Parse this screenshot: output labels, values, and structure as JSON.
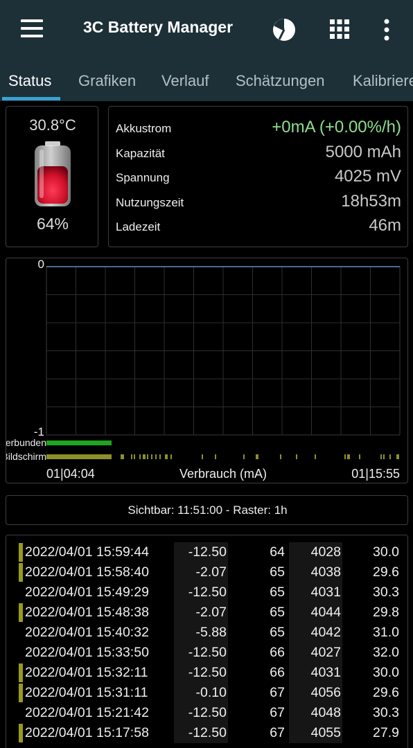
{
  "app": {
    "title": "3C Battery Manager",
    "icons": [
      "menu-icon",
      "pie-chart-icon",
      "grid-icon",
      "more-vert-icon"
    ]
  },
  "tabs": [
    {
      "label": "Status",
      "active": true
    },
    {
      "label": "Grafiken",
      "active": false
    },
    {
      "label": "Verlauf",
      "active": false
    },
    {
      "label": "Schätzungen",
      "active": false
    },
    {
      "label": "Kalibrieren",
      "active": false
    }
  ],
  "battery": {
    "temperature": "30.8°C",
    "percent": "64%"
  },
  "info": [
    {
      "label": "Akkustrom",
      "value": "+0mA (+0.00%/h)",
      "color": "#8ee08e"
    },
    {
      "label": "Kapazität",
      "value": "5000 mAh"
    },
    {
      "label": "Spannung",
      "value": "4025 mV"
    },
    {
      "label": "Nutzungszeit",
      "value": "18h53m"
    },
    {
      "label": "Ladezeit",
      "value": "46m"
    }
  ],
  "chart_data": {
    "type": "line",
    "ylim": [
      -1,
      0
    ],
    "y_ticks": [
      "0",
      "-1"
    ],
    "x_start": "01|04:04",
    "x_end": "01|15:55",
    "xlabel": "Verbrauch (mA)",
    "series": [
      {
        "values": [
          0,
          0
        ]
      }
    ],
    "tracks": [
      {
        "name": "Verbunden",
        "color": "#1fa51f"
      },
      {
        "name": "Bildschirm",
        "color": "#8f8f2a"
      }
    ]
  },
  "visible": {
    "text": "Sichtbar: 11:51:00 - Raster: 1h"
  },
  "history": [
    {
      "marker": true,
      "datetime": "2022/04/01 15:59:44",
      "ma": "-12.50",
      "pct": "64",
      "mv": "4028",
      "temp": "30.0"
    },
    {
      "marker": true,
      "datetime": "2022/04/01 15:58:40",
      "ma": "-2.07",
      "pct": "65",
      "mv": "4038",
      "temp": "29.6"
    },
    {
      "marker": false,
      "datetime": "2022/04/01 15:49:29",
      "ma": "-12.50",
      "pct": "65",
      "mv": "4031",
      "temp": "30.3"
    },
    {
      "marker": true,
      "datetime": "2022/04/01 15:48:38",
      "ma": "-2.07",
      "pct": "65",
      "mv": "4044",
      "temp": "29.8"
    },
    {
      "marker": false,
      "datetime": "2022/04/01 15:40:32",
      "ma": "-5.88",
      "pct": "65",
      "mv": "4042",
      "temp": "31.0"
    },
    {
      "marker": false,
      "datetime": "2022/04/01 15:33:50",
      "ma": "-12.50",
      "pct": "66",
      "mv": "4027",
      "temp": "32.0"
    },
    {
      "marker": true,
      "datetime": "2022/04/01 15:32:11",
      "ma": "-12.50",
      "pct": "66",
      "mv": "4031",
      "temp": "30.0"
    },
    {
      "marker": true,
      "datetime": "2022/04/01 15:31:11",
      "ma": "-0.10",
      "pct": "67",
      "mv": "4056",
      "temp": "29.6"
    },
    {
      "marker": false,
      "datetime": "2022/04/01 15:21:42",
      "ma": "-12.50",
      "pct": "67",
      "mv": "4048",
      "temp": "30.3"
    },
    {
      "marker": true,
      "datetime": "2022/04/01 15:17:58",
      "ma": "-12.50",
      "pct": "67",
      "mv": "4055",
      "temp": "27.9"
    }
  ]
}
